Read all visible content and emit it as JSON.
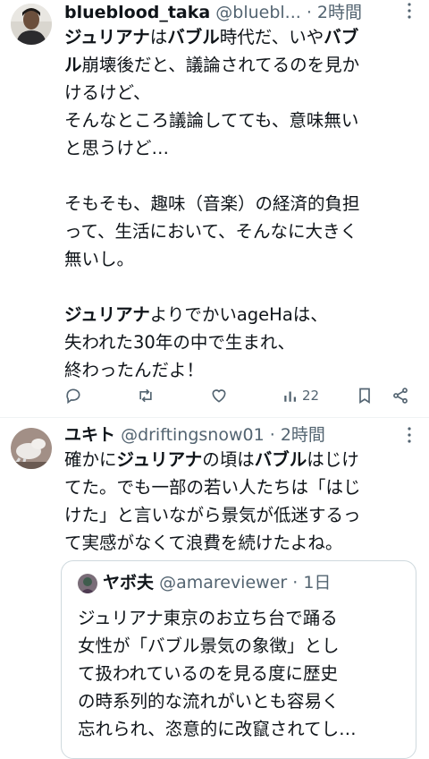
{
  "tweet1": {
    "name": "blueblood_taka",
    "handle": "@bluebl...",
    "time": "· 2時間",
    "body_parts": [
      {
        "t": "ジュリアナ",
        "b": true
      },
      {
        "t": "は",
        "b": false
      },
      {
        "t": "バブル",
        "b": true
      },
      {
        "t": "時代だ、いや",
        "b": false
      },
      {
        "t": "バブ\nル",
        "b": true
      },
      {
        "t": "崩壊後だと、議論されてるのを見か\nけるけど、\nそんなところ議論してても、意味無い\nと思うけど…\n\nそもそも、趣味（音楽）の経済的負担\nって、生活において、そんなに大きく\n無いし。\n\n",
        "b": false
      },
      {
        "t": "ジュリアナ",
        "b": true
      },
      {
        "t": "よりでかいageHaは、\n失われた30年の中で生まれ、\n終わったんだよ！",
        "b": false
      }
    ],
    "views": "22",
    "actions": [
      "reply-icon",
      "retweet-icon",
      "like-icon",
      "views-icon",
      "bookmark-icon",
      "share-icon"
    ]
  },
  "tweet2": {
    "name": "ユキト",
    "handle": "@driftingsnow01",
    "time": "· 2時間",
    "body_parts": [
      {
        "t": "確かに",
        "b": false
      },
      {
        "t": "ジュリアナ",
        "b": true
      },
      {
        "t": "の頃は",
        "b": false
      },
      {
        "t": "バブル",
        "b": true
      },
      {
        "t": "はじけ\nてた。でも一部の若い人たちは「はじ\nけた」と言いながら景気が低迷するっ\nて実感がなくて浪費を続けたよね。",
        "b": false
      }
    ],
    "quote": {
      "name": "ヤボ夫",
      "handle": "@amareviewer",
      "time": "· 1日",
      "body": "ジュリアナ東京のお立ち台で踊る\n女性が「バブル景気の象徴」とし\nて扱われているのを見る度に歴史\nの時系列的な流れがいとも容易く\n忘れられ、恣意的に改竄されてし…"
    }
  }
}
